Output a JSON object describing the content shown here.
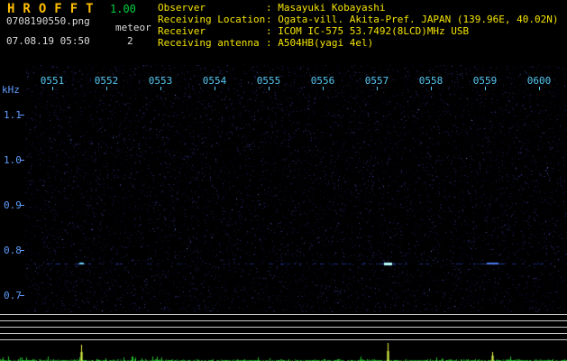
{
  "colors": {
    "background": "#000000",
    "title_yellow": "#ffbe00",
    "version_green": "#00d040",
    "info_yellow": "#f4e300",
    "white": "#dcdcdc",
    "axis_blue": "#5f9dff",
    "time_cyan": "#56c8f0",
    "grid_gray": "#c8c8c8",
    "spike_green": "#28d232",
    "spike_yellow": "#f0f040"
  },
  "header": {
    "app_title": "HROFFT",
    "version": "1.00",
    "filename": "0708190550.png",
    "meteor_label": "meteor",
    "meteor_count": "2",
    "datetime": "07.08.19 05:50",
    "info_separator": ": ",
    "info_rows": [
      {
        "label": "Observer",
        "value": "Masayuki Kobayashi"
      },
      {
        "label": "Receiving Location",
        "value": "Ogata-vill. Akita-Pref. JAPAN (139.96E, 40.02N)"
      },
      {
        "label": "Receiver",
        "value": "ICOM IC-575 53.7492(8LCD)MHz USB"
      },
      {
        "label": "Receiving antenna",
        "value": "A504HB(yagi 4el)"
      }
    ]
  },
  "chart_data": {
    "type": "heatmap",
    "title": "HROFFT radio meteor echo spectrogram 05:50-06:00",
    "x_axis": {
      "tick_labels": [
        "0551",
        "0552",
        "0553",
        "0554",
        "0555",
        "0556",
        "0557",
        "0558",
        "0559",
        "0600"
      ]
    },
    "y_axis": {
      "unit_label": "kHz",
      "tick_labels": [
        "1.1",
        "1.0",
        "0.9",
        "0.8",
        "0.7"
      ],
      "top_khz": 1.21,
      "bottom_khz": 0.66
    },
    "carrier_freq_khz": 0.77,
    "meteor_count": 2,
    "echoes": [
      {
        "x_frac": 0.103,
        "freq_khz": 0.77,
        "strength": "weak",
        "approx_time": "0551"
      },
      {
        "x_frac": 0.669,
        "freq_khz": 0.77,
        "strength": "strong",
        "approx_time": "0557"
      },
      {
        "x_frac": 0.862,
        "freq_khz": 0.77,
        "strength": "medium",
        "approx_time": "0559"
      }
    ],
    "signal_meter": {
      "major_spikes": [
        {
          "x_frac": 0.143,
          "height_frac": 0.8
        },
        {
          "x_frac": 0.684,
          "height_frac": 0.88
        },
        {
          "x_frac": 0.868,
          "height_frac": 0.42
        }
      ]
    }
  }
}
